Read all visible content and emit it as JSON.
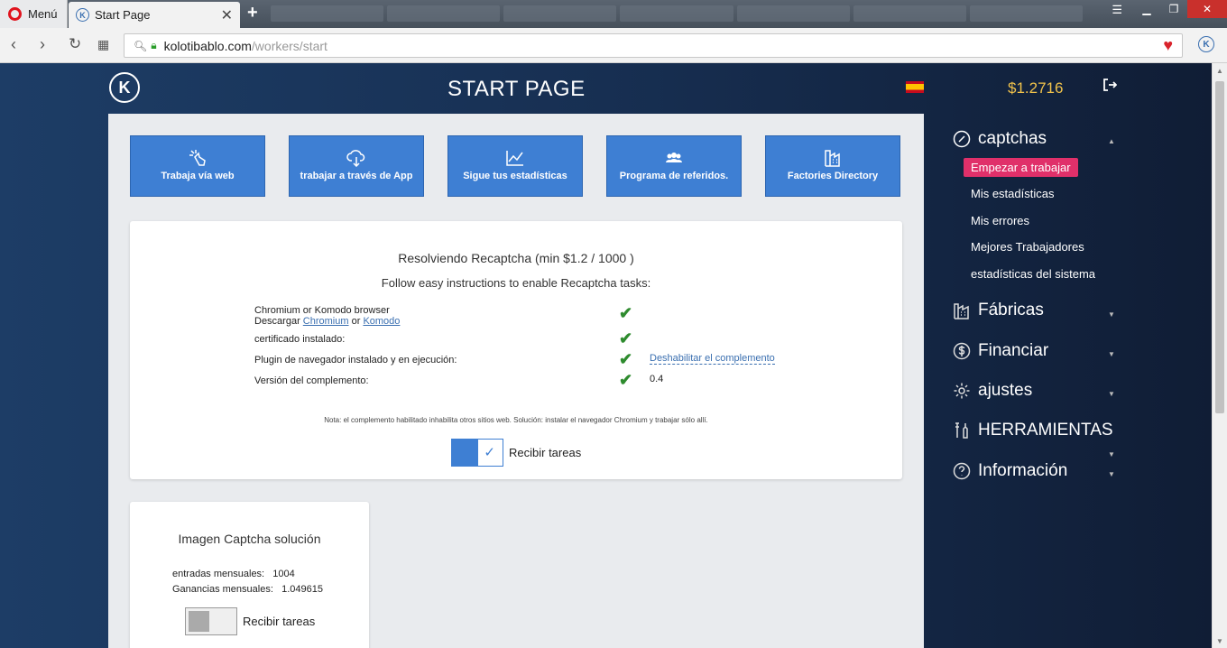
{
  "browser": {
    "menu_label": "Menú",
    "tab_title": "Start Page",
    "url_host": "kolotibablo.com",
    "url_path": "/workers/start",
    "new_tab_symbol": "+"
  },
  "header": {
    "title": "START PAGE",
    "balance": "$1.2716",
    "language_flag": "es"
  },
  "tiles": [
    {
      "label": "Trabaja vía web",
      "icon": "hand-click-icon"
    },
    {
      "label": "trabajar a través de App",
      "icon": "cloud-download-icon"
    },
    {
      "label": "Sigue tus estadísticas",
      "icon": "chart-icon"
    },
    {
      "label": "Programa de referidos.",
      "icon": "people-icon"
    },
    {
      "label": "Factories Directory",
      "icon": "factory-icon"
    }
  ],
  "recaptcha": {
    "title": "Resolviendo Recaptcha (min $1.2 / 1000 )",
    "subtitle": "Follow easy instructions to enable Recaptcha tasks:",
    "req1_line1": "Chromium or Komodo browser",
    "req1_line2_prefix": "Descargar ",
    "req1_link1": "Chromium",
    "req1_or": " or ",
    "req1_link2": "Komodo",
    "req2": "certificado instalado:",
    "req3": "Plugin de navegador instalado y en ejecución:",
    "req3_action": "Deshabilitar el complemento",
    "req4": "Versión del complemento:",
    "req4_value": "0.4",
    "note": "Nota: el complemento habilitado inhabilita otros sitios web. Solución: instalar el navegador Chromium y trabajar sólo allí.",
    "toggle_label": "Recibir tareas",
    "toggle_on": true
  },
  "image_captcha": {
    "title": "Imagen Captcha solución",
    "monthly_entries_label": "entradas mensuales:",
    "monthly_entries_value": "1004",
    "monthly_earnings_label": "Ganancias mensuales:",
    "monthly_earnings_value": "1.049615",
    "toggle_label": "Recibir tareas",
    "toggle_on": false
  },
  "sidebar": {
    "sections": [
      {
        "label": "captchas",
        "icon": "gauge-icon"
      },
      {
        "label": "Fábricas",
        "icon": "factory-icon"
      },
      {
        "label": "Financiar",
        "icon": "dollar-icon"
      },
      {
        "label": "ajustes",
        "icon": "gear-icon"
      },
      {
        "label": "HERRAMIENTAS",
        "icon": "tools-icon"
      },
      {
        "label": "Información",
        "icon": "question-icon"
      }
    ],
    "captchas_items": [
      {
        "label": "Empezar a trabajar",
        "active": true
      },
      {
        "label": "Mis estadísticas"
      },
      {
        "label": "Mis errores"
      },
      {
        "label": "Mejores Trabajadores"
      },
      {
        "label": "estadísticas del sistema"
      }
    ]
  },
  "colors": {
    "accent_blue": "#3e7fd3",
    "active_pink": "#e0306a",
    "balance_gold": "#f0c24b",
    "check_green": "#2e8b2e"
  }
}
